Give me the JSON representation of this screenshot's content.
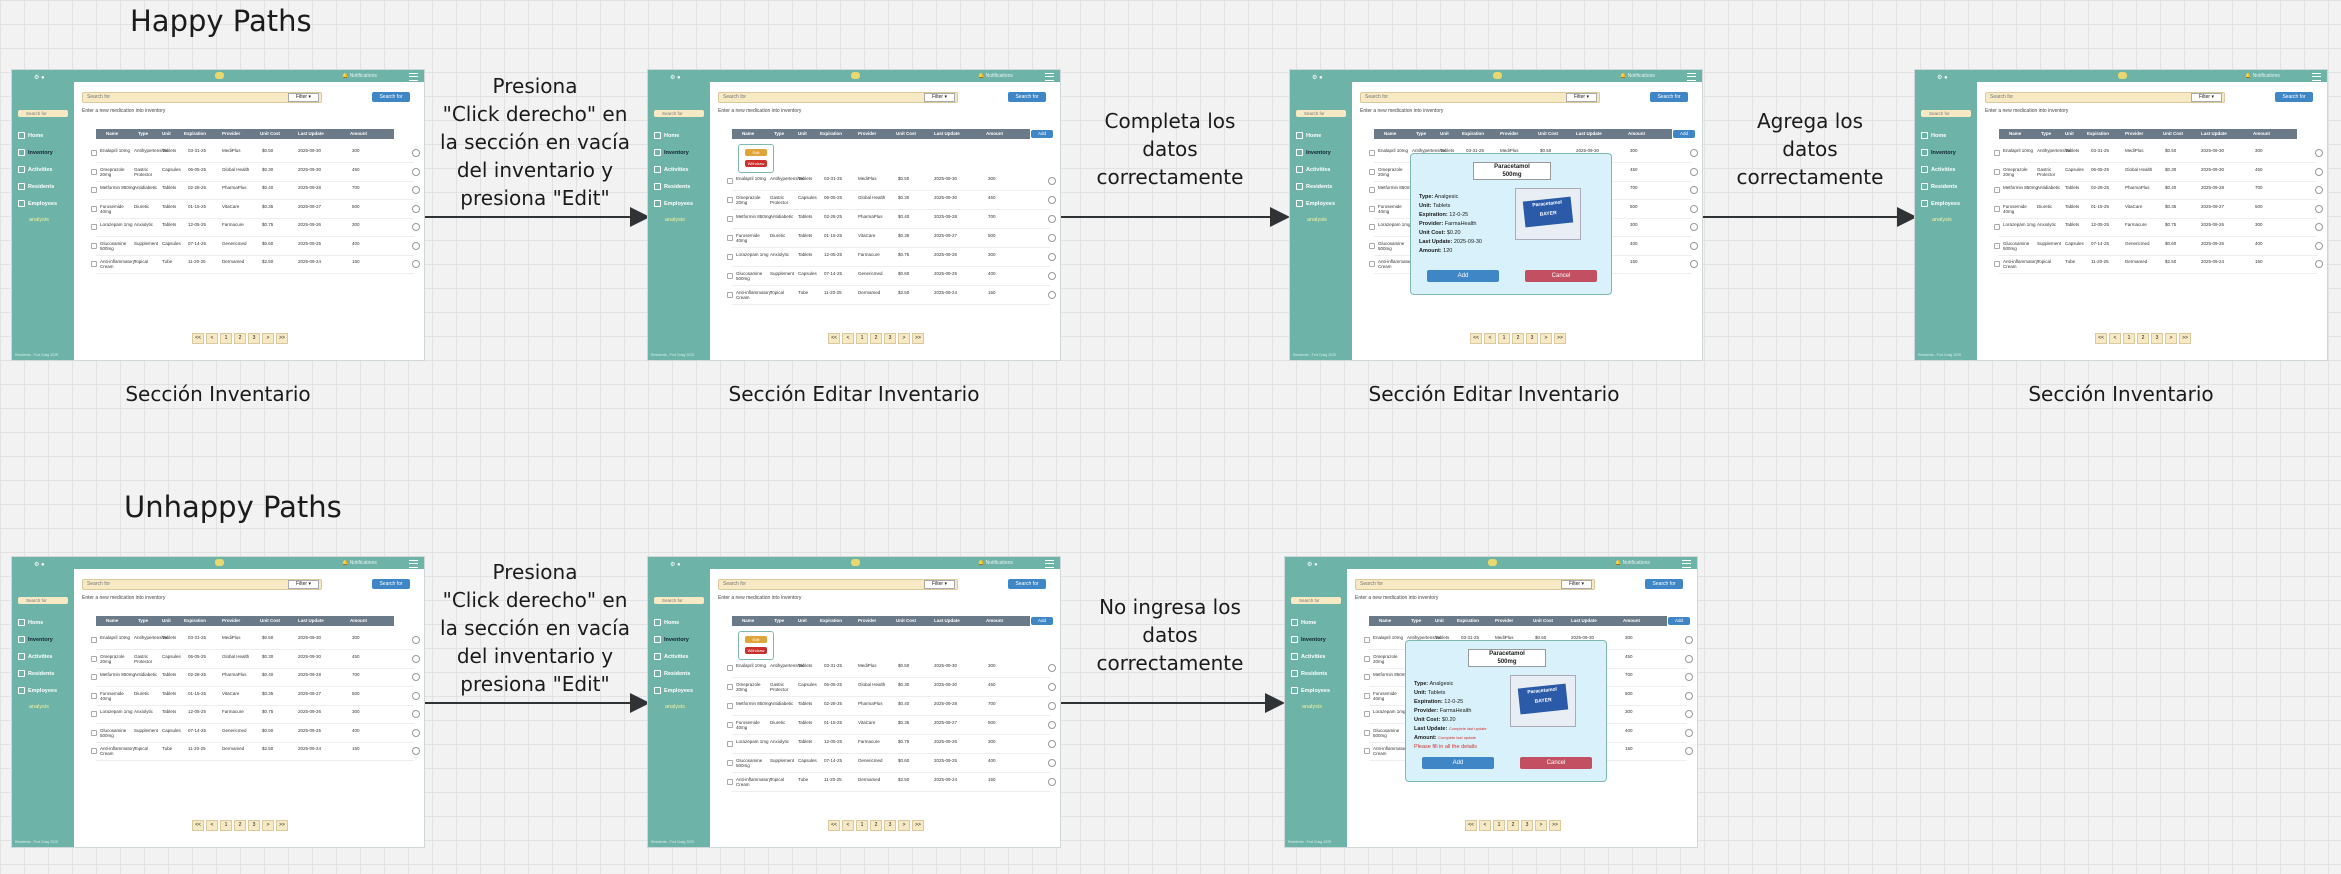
{
  "happy_heading": "Happy Paths",
  "unhappy_heading": "Unhappy Paths",
  "captions": [
    "Sección Inventario",
    "Sección Editar Inventario",
    "Sección Editar Inventario",
    "Sección Inventario"
  ],
  "happy_steps": [
    [
      "Presiona",
      "\"Click derecho\" en",
      "la sección en vacía",
      "del inventario y",
      "presiona \"Edit\""
    ],
    [
      "Completa los",
      "datos",
      "correctamente"
    ],
    [
      "Agrega los",
      "datos",
      "correctamente"
    ]
  ],
  "unhappy_steps": [
    [
      "Presiona",
      "\"Click derecho\" en",
      "la sección en vacía",
      "del inventario y",
      "presiona \"Edit\""
    ],
    [
      "No ingresa los",
      "datos",
      "correctamente"
    ]
  ],
  "app": {
    "notifications": "Notifications",
    "sidebar_search": "Search for",
    "nav": [
      "Home",
      "Inventory",
      "Activities",
      "Residents",
      "Employees"
    ],
    "analysis": "analysis",
    "footer": "Residents - Fort Craig 2025",
    "search_placeholder": "Search for",
    "filter": "Filter",
    "search_button": "Search for",
    "hint": "Enter a new medication into inventory",
    "add_button": "Add",
    "columns": [
      "Name",
      "Type",
      "Unit",
      "Expiration",
      "Provider",
      "Unit Cost",
      "Last Update",
      "Amount"
    ],
    "rows": [
      [
        "Enalapril 10mg",
        "Antihypertensive",
        "Tablets",
        "03-31-25",
        "MediPlus",
        "$0.50",
        "2025-09-30",
        "300"
      ],
      [
        "Omeprazole 20mg",
        "Gastric Protector",
        "Capsules",
        "06-05-25",
        "Global Health",
        "$0.30",
        "2025-09-30",
        "450"
      ],
      [
        "Metformin 850mg",
        "Antidiabetic",
        "Tablets",
        "02-28-25",
        "PharmaPlus",
        "$0.40",
        "2025-09-28",
        "700"
      ],
      [
        "Furosemide 40mg",
        "Diuretic",
        "Tablets",
        "01-15-25",
        "VitaCare",
        "$0.35",
        "2025-09-27",
        "500"
      ],
      [
        "Lorazepam 1mg",
        "Anxiolytic",
        "Tablets",
        "12-05-25",
        "Farmacure",
        "$0.75",
        "2025-09-26",
        "300"
      ],
      [
        "Glucosamine 500mg",
        "Supplement",
        "Capsules",
        "07-14-25",
        "Genericmed",
        "$0.60",
        "2025-09-25",
        "400"
      ],
      [
        "Anti-inflammatory Cream",
        "Topical",
        "Tube",
        "11-20-25",
        "Dermamed",
        "$2.50",
        "2025-09-24",
        "150"
      ]
    ],
    "pager": [
      "<<",
      "<",
      "1",
      "2",
      "3",
      ">",
      ">>"
    ],
    "context_menu": {
      "edit": "Edit",
      "delete": "Withdraw"
    },
    "modal": {
      "title_line1": "Paracetamol",
      "title_line2": "500mg",
      "fields": [
        {
          "label": "Type:",
          "value": "Analgesic"
        },
        {
          "label": "Unit:",
          "value": "Tablets"
        },
        {
          "label": "Expiration:",
          "value": "12-0-25"
        },
        {
          "label": "Provider:",
          "value": "FarmaHealth"
        },
        {
          "label": "Unit Cost:",
          "value": "$0.20"
        },
        {
          "label": "Last Update:",
          "value": "2025-09-30"
        },
        {
          "label": "Amount:",
          "value": "120"
        }
      ],
      "incomplete_note": "Complete last update",
      "error": "Please fill in all the details",
      "box_text": "Paracetamol BAYER",
      "add": "Add",
      "cancel": "Cancel"
    }
  }
}
